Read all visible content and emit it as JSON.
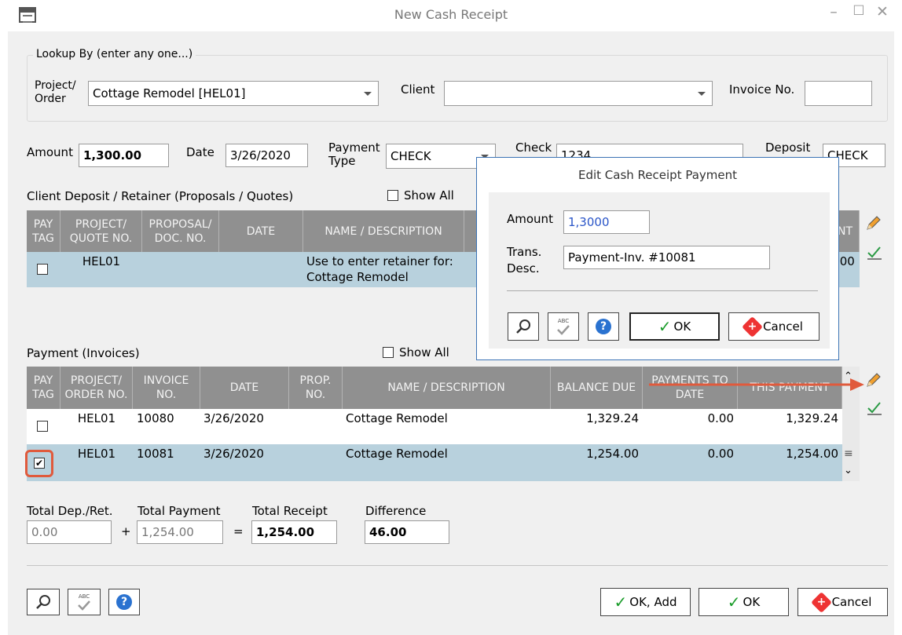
{
  "window": {
    "title": "New Cash Receipt",
    "minimize": "–",
    "maximize": "☐",
    "close": "✕"
  },
  "lookup": {
    "group_label": "Lookup By (enter any one...)",
    "project_label_1": "Project/",
    "project_label_2": "Order",
    "project_value": "Cottage Remodel  [HEL01]",
    "client_label": "Client",
    "client_value": "",
    "invoice_label": "Invoice No.",
    "invoice_value": ""
  },
  "form": {
    "amount_label": "Amount",
    "amount_value": "1,300.00",
    "date_label": "Date",
    "date_value": "3/26/2020",
    "payment_type_label_1": "Payment",
    "payment_type_label_2": "Type",
    "payment_type_value": "CHECK",
    "check_label": "Check",
    "check_value": "1234",
    "deposit_label": "Deposit",
    "deposit_value": "CHECK"
  },
  "deposit_grid": {
    "title": "Client Deposit / Retainer (Proposals / Quotes)",
    "show_all": "Show All",
    "headers": [
      "PAY TAG",
      "PROJECT/ QUOTE NO.",
      "PROPOSAL/ DOC. NO.",
      "DATE",
      "NAME / DESCRIPTION",
      "NT"
    ],
    "rows": [
      {
        "project": "HEL01",
        "doc": "",
        "date": "",
        "desc_1": "Use to enter retainer for:",
        "desc_2": "Cottage Remodel",
        "amount": ".00"
      }
    ]
  },
  "payment_grid": {
    "title": "Payment (Invoices)",
    "show_all": "Show All",
    "headers": [
      "PAY TAG",
      "PROJECT/ ORDER NO.",
      "INVOICE NO.",
      "DATE",
      "PROP. NO.",
      "NAME / DESCRIPTION",
      "BALANCE DUE",
      "PAYMENTS TO DATE",
      "THIS PAYMENT"
    ],
    "rows": [
      {
        "checked": false,
        "project": "HEL01",
        "invoice": "10080",
        "date": "3/26/2020",
        "prop": "",
        "desc": "Cottage Remodel",
        "balance": "1,329.24",
        "paid": "0.00",
        "this": "1,329.24"
      },
      {
        "checked": true,
        "project": "HEL01",
        "invoice": "10081",
        "date": "3/26/2020",
        "prop": "",
        "desc": "Cottage Remodel",
        "balance": "1,254.00",
        "paid": "0.00",
        "this": "1,254.00"
      }
    ]
  },
  "totals": {
    "dep_label": "Total Dep./Ret.",
    "dep_value": "0.00",
    "plus": "+",
    "pay_label": "Total Payment",
    "pay_value": "1,254.00",
    "equals": "=",
    "receipt_label": "Total Receipt",
    "receipt_value": "1,254.00",
    "diff_label": "Difference",
    "diff_value": "46.00"
  },
  "buttons": {
    "ok_add": "OK, Add",
    "ok": "OK",
    "cancel": "Cancel",
    "help": "?",
    "spell": "ABC"
  },
  "dialog": {
    "title": "Edit Cash Receipt Payment",
    "amount_label": "Amount",
    "amount_value": "1,3000",
    "desc_label_1": "Trans.",
    "desc_label_2": "Desc.",
    "desc_value": "Payment-Inv. #10081",
    "help": "?",
    "spell": "ABC",
    "ok": "OK",
    "cancel": "Cancel"
  },
  "colors": {
    "grid_header": "#909090",
    "selected_row": "#b8d1dd",
    "highlight": "#e05a3c",
    "ok_green": "#1a9c2a",
    "cancel_red": "#e33333",
    "dialog_border": "#3b73b5"
  }
}
